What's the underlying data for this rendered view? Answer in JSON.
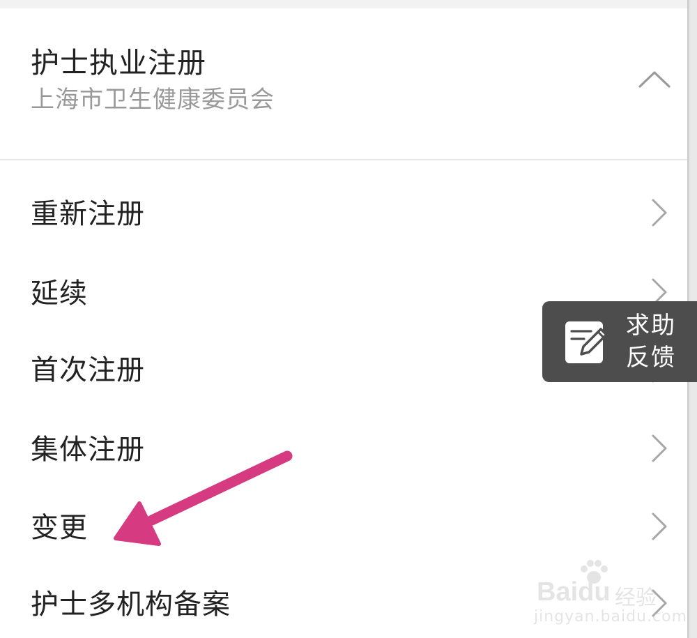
{
  "header": {
    "title": "护士执业注册",
    "subtitle": "上海市卫生健康委员会"
  },
  "menu": {
    "items": [
      {
        "label": "重新注册"
      },
      {
        "label": "延续"
      },
      {
        "label": "首次注册"
      },
      {
        "label": "集体注册"
      },
      {
        "label": "变更"
      },
      {
        "label": "护士多机构备案"
      }
    ]
  },
  "feedback": {
    "line1": "求助",
    "line2": "反馈",
    "icon": "edit-note-icon"
  },
  "annotation": {
    "arrow_color": "#d63a80"
  },
  "watermark": {
    "brand": "Bai",
    "brand_suffix": "du",
    "cn": "经验",
    "url": "jingyan.baidu.com"
  }
}
